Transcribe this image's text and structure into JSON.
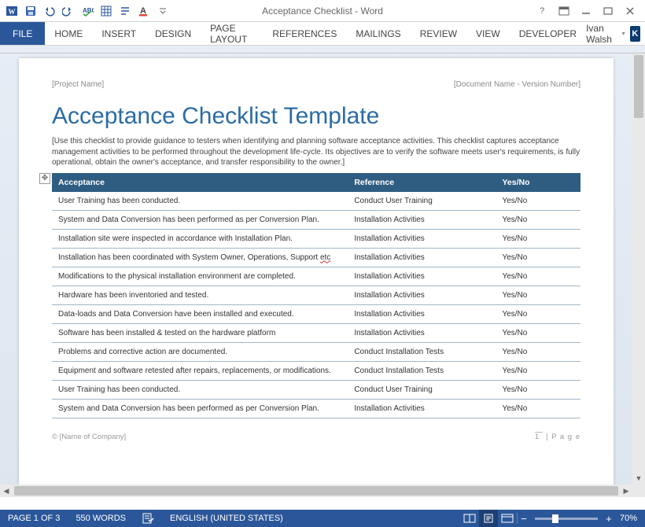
{
  "titlebar": {
    "title": "Acceptance Checklist - Word"
  },
  "ribbon": {
    "file": "FILE",
    "tabs": [
      "HOME",
      "INSERT",
      "DESIGN",
      "PAGE LAYOUT",
      "REFERENCES",
      "MAILINGS",
      "REVIEW",
      "VIEW",
      "DEVELOPER"
    ],
    "user": "Ivan Walsh",
    "user_initial": "K"
  },
  "document": {
    "header_left": "[Project Name]",
    "header_right": "[Document Name - Version Number]",
    "title": "Acceptance Checklist Template",
    "intro": "[Use this checklist to provide guidance to testers when identifying and planning software acceptance activities. This checklist captures acceptance management activities to be performed throughout the development life-cycle. Its objectives are to verify the software meets user's requirements, is fully operational, obtain the owner's acceptance, and transfer responsibility to the owner.]",
    "columns": {
      "acceptance": "Acceptance",
      "reference": "Reference",
      "yesno": "Yes/No"
    },
    "rows": [
      {
        "acc": "User Training has been conducted.",
        "ref": "Conduct User Training",
        "yn": "Yes/No"
      },
      {
        "acc": "System and Data Conversion has been performed as per Conversion Plan.",
        "ref": "Installation Activities",
        "yn": "Yes/No"
      },
      {
        "acc": "Installation site were inspected in accordance with Installation Plan.",
        "ref": "Installation Activities",
        "yn": "Yes/No"
      },
      {
        "acc": "Installation has been coordinated with System Owner, Operations, Support ",
        "err": "etc",
        "ref": "Installation Activities",
        "yn": "Yes/No"
      },
      {
        "acc": "Modifications to the physical installation environment are completed.",
        "ref": "Installation Activities",
        "yn": "Yes/No"
      },
      {
        "acc": "Hardware has been inventoried and tested.",
        "ref": "Installation Activities",
        "yn": "Yes/No"
      },
      {
        "acc": "Data-loads and Data Conversion have been installed and executed.",
        "ref": "Installation Activities",
        "yn": "Yes/No"
      },
      {
        "acc": "Software has been installed & tested on the hardware platform",
        "ref": "Installation Activities",
        "yn": "Yes/No"
      },
      {
        "acc": "Problems and corrective action are documented.",
        "ref": "Conduct Installation Tests",
        "yn": "Yes/No"
      },
      {
        "acc": "Equipment and software retested after repairs, replacements, or modifications.",
        "ref": "Conduct Installation Tests",
        "yn": "Yes/No"
      },
      {
        "acc": "User Training has been conducted.",
        "ref": "Conduct User Training",
        "yn": "Yes/No"
      },
      {
        "acc": "System and Data Conversion has been performed as per Conversion Plan.",
        "ref": "Installation Activities",
        "yn": "Yes/No"
      }
    ],
    "footer_left": "© [Name of Company]",
    "footer_page_num": "1",
    "footer_page_lbl": "P a g e"
  },
  "statusbar": {
    "page": "PAGE 1 OF 3",
    "words": "550 WORDS",
    "lang": "ENGLISH (UNITED STATES)",
    "zoom": "70%"
  }
}
